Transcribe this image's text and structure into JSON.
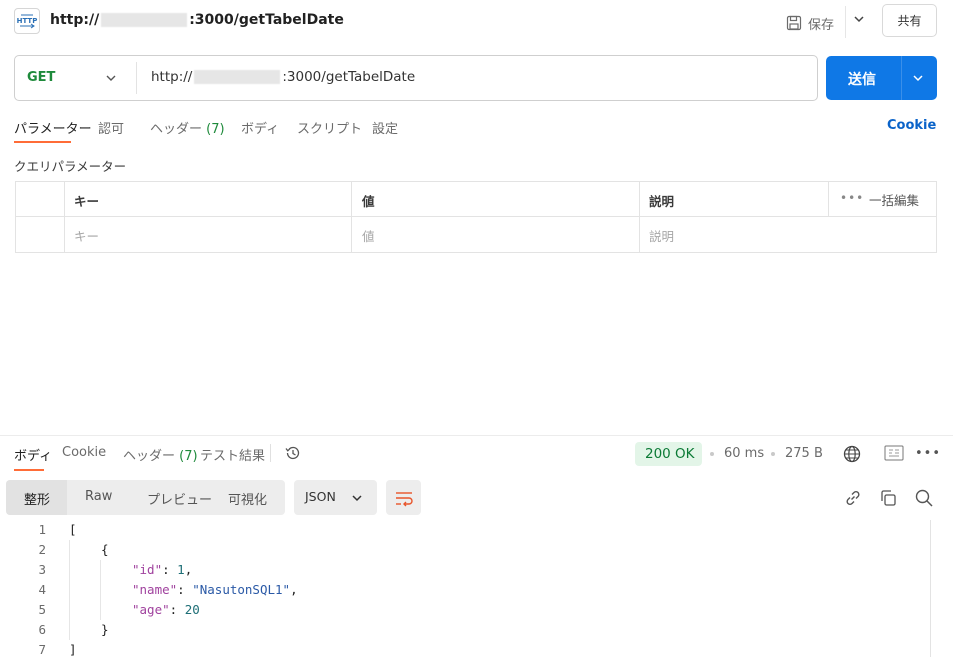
{
  "header": {
    "title_prefix": "http://",
    "title_suffix": ":3000/getTabelDate",
    "save_label": "保存",
    "share_label": "共有",
    "icon_text": "HTTP"
  },
  "request": {
    "method": "GET",
    "url_prefix": "http://",
    "url_suffix": ":3000/getTabelDate",
    "send_label": "送信"
  },
  "request_tabs": {
    "params": "パラメーター",
    "auth": "認可",
    "headers": "ヘッダー",
    "headers_count": "(7)",
    "body": "ボディ",
    "scripts": "スクリプト",
    "settings": "設定",
    "cookie": "Cookie"
  },
  "query_params": {
    "title": "クエリパラメーター",
    "headers": {
      "key": "キー",
      "value": "値",
      "description": "説明"
    },
    "placeholders": {
      "key": "キー",
      "value": "値",
      "description": "説明"
    },
    "more": "•••",
    "bulk_edit": "一括編集"
  },
  "response_tabs": {
    "body": "ボディ",
    "cookie": "Cookie",
    "headers": "ヘッダー",
    "headers_count": "(7)",
    "test_results": "テスト結果"
  },
  "response_meta": {
    "status": "200 OK",
    "time": "60 ms",
    "size": "275 B",
    "more": "•••"
  },
  "format_tabs": {
    "pretty": "整形",
    "raw": "Raw",
    "preview": "プレビュー",
    "visualize": "可視化",
    "language": "JSON"
  },
  "code": {
    "line_numbers": [
      "1",
      "2",
      "3",
      "4",
      "5",
      "6",
      "7"
    ],
    "open_bracket": "[",
    "open_brace": "{",
    "id_key": "\"id\"",
    "id_val": "1",
    "name_key": "\"name\"",
    "name_val": "\"NasutonSQL1\"",
    "age_key": "\"age\"",
    "age_val": "20",
    "close_brace": "}",
    "close_bracket": "]"
  },
  "colors": {
    "accent_orange": "#ff6c37",
    "send_blue": "#0f78e6",
    "method_green": "#1e8a3b",
    "status_green": "#0b7a35"
  }
}
